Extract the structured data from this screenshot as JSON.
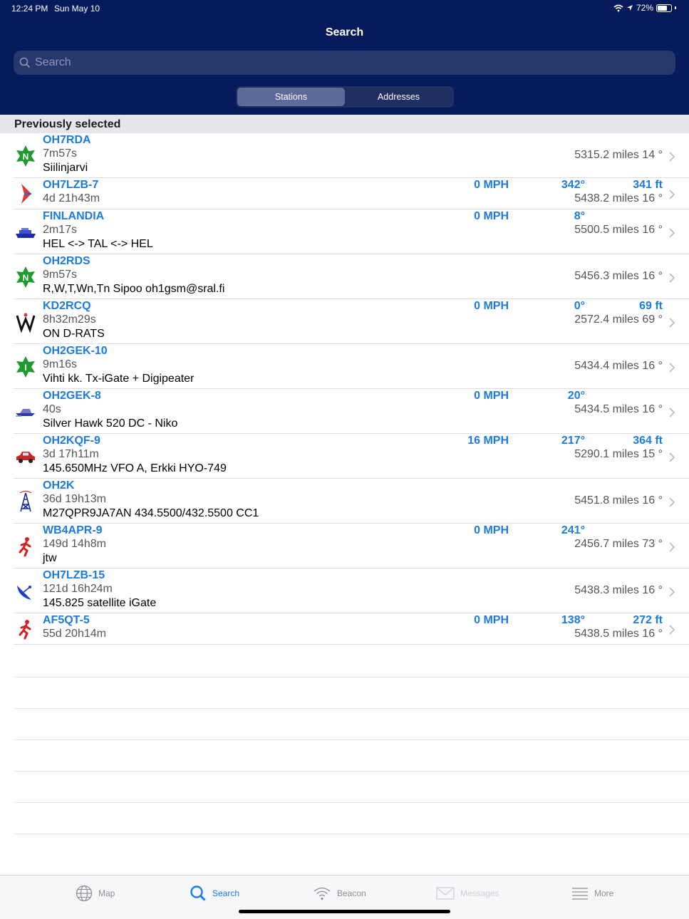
{
  "status_bar": {
    "time": "12:24 PM",
    "date": "Sun May 10",
    "battery": "72%"
  },
  "nav": {
    "title": "Search"
  },
  "search": {
    "placeholder": "Search",
    "value": ""
  },
  "segments": {
    "stations": "Stations",
    "addresses": "Addresses",
    "selected": "Stations"
  },
  "section": {
    "title": "Previously selected"
  },
  "stations": [
    {
      "icon": "green-star-n-icon",
      "callsign": "OH7RDA",
      "age": "7m57s",
      "comment": "Siilinjarvi",
      "speed": "",
      "course": "",
      "altitude": "",
      "distance": "5315.2 miles 14 °"
    },
    {
      "icon": "jet-plane-icon",
      "callsign": "OH7LZB-7",
      "age": "4d 21h43m",
      "comment": "",
      "speed": "0 MPH",
      "course": "342°",
      "altitude": "341 ft",
      "distance": "5438.2 miles 16 °"
    },
    {
      "icon": "ship-icon",
      "callsign": "FINLANDIA",
      "age": "2m17s",
      "comment": "HEL <-> TAL <-> HEL",
      "speed": "0 MPH",
      "course": "8°",
      "altitude": "",
      "distance": "5500.5 miles 16 °"
    },
    {
      "icon": "green-star-n-icon",
      "callsign": "OH2RDS",
      "age": "9m57s",
      "comment": "R,W,T,Wn,Tn Sipoo oh1gsm@sral.fi",
      "speed": "",
      "course": "",
      "altitude": "",
      "distance": "5456.3 miles 16 °"
    },
    {
      "icon": "w-symbol-icon",
      "callsign": "KD2RCQ",
      "age": "8h32m29s",
      "comment": "ON D-RATS",
      "speed": "0 MPH",
      "course": "0°",
      "altitude": "69 ft",
      "distance": "2572.4 miles 69 °"
    },
    {
      "icon": "green-star-i-icon",
      "callsign": "OH2GEK-10",
      "age": "9m16s",
      "comment": "Vihti kk. Tx-iGate + Digipeater",
      "speed": "",
      "course": "",
      "altitude": "",
      "distance": "5434.4 miles 16 °"
    },
    {
      "icon": "boat-icon",
      "callsign": "OH2GEK-8",
      "age": "40s",
      "comment": "Silver Hawk 520 DC - Niko",
      "speed": "0 MPH",
      "course": "20°",
      "altitude": "",
      "distance": "5434.5 miles 16 °"
    },
    {
      "icon": "car-icon",
      "callsign": "OH2KQF-9",
      "age": "3d 17h11m",
      "comment": "145.650MHz VFO A, Erkki HYO-749",
      "speed": "16 MPH",
      "course": "217°",
      "altitude": "364 ft",
      "distance": "5290.1 miles 15 °"
    },
    {
      "icon": "radio-tower-icon",
      "callsign": "OH2K",
      "age": "36d 19h13m",
      "comment": "M27QPR9JA7AN 434.5500/432.5500 CC1",
      "speed": "",
      "course": "",
      "altitude": "",
      "distance": "5451.8 miles 16 °"
    },
    {
      "icon": "jogger-icon",
      "callsign": "WB4APR-9",
      "age": "149d 14h8m",
      "comment": "jtw",
      "speed": "0 MPH",
      "course": "241°",
      "altitude": "",
      "distance": "2456.7 miles 73 °"
    },
    {
      "icon": "satellite-dish-icon",
      "callsign": "OH7LZB-15",
      "age": "121d 16h24m",
      "comment": "145.825 satellite iGate",
      "speed": "",
      "course": "",
      "altitude": "",
      "distance": "5438.3 miles 16 °"
    },
    {
      "icon": "jogger-icon",
      "callsign": "AF5QT-5",
      "age": "55d 20h14m",
      "comment": "",
      "speed": "0 MPH",
      "course": "138°",
      "altitude": "272 ft",
      "distance": "5438.5 miles 16 °"
    }
  ],
  "tabs": [
    {
      "label": "Map",
      "icon": "globe-icon",
      "state": "normal"
    },
    {
      "label": "Search",
      "icon": "search-icon",
      "state": "active"
    },
    {
      "label": "Beacon",
      "icon": "wifi-icon",
      "state": "normal"
    },
    {
      "label": "Messages",
      "icon": "envelope-icon",
      "state": "disabled"
    },
    {
      "label": "More",
      "icon": "list-icon",
      "state": "normal"
    }
  ],
  "colors": {
    "header_bg": "#071a5c",
    "accent": "#1c7be0",
    "green_star": "#1e9b2e"
  }
}
